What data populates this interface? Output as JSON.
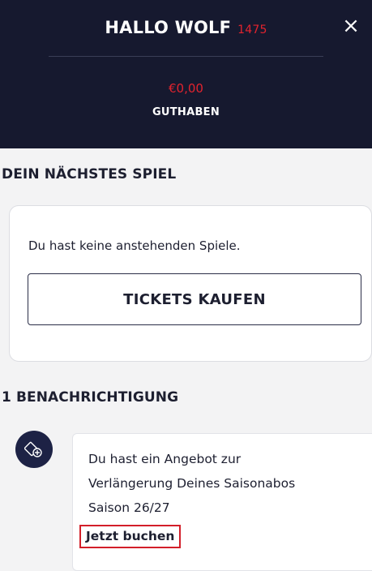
{
  "header": {
    "greeting": "HALLO WOLF",
    "user_number": "1475",
    "close_label": "×",
    "balance_amount": "€0,00",
    "balance_label": "GUTHABEN"
  },
  "next_game": {
    "title": "DEIN NÄCHSTES SPIEL",
    "empty_message": "Du hast keine anstehenden Spiele.",
    "button_label": "TICKETS KAUFEN"
  },
  "notifications": {
    "title": "1 BENACHRICHTIGUNG",
    "items": [
      {
        "icon": "ticket-plus-icon",
        "line1": "Du hast ein Angebot zur",
        "line2": "Verlängerung Deines Saisonabos",
        "line3": "Saison 26/27",
        "link_label": "Jetzt buchen"
      }
    ]
  },
  "colors": {
    "header_bg": "#16192f",
    "accent_red": "#e2232e",
    "page_bg": "#f3f3f4",
    "icon_bg": "#1d2245"
  }
}
